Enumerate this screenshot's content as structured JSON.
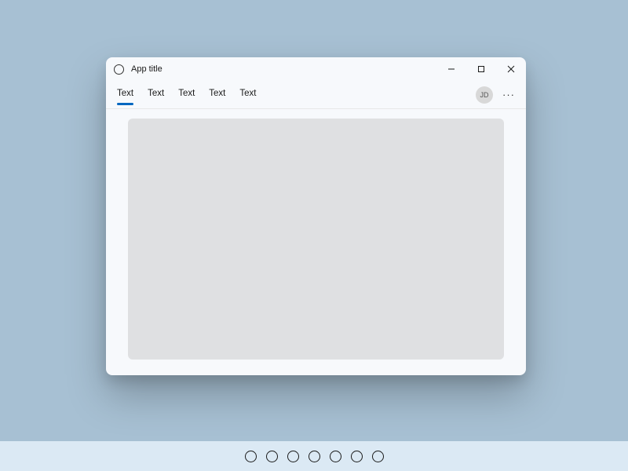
{
  "window": {
    "title": "App title",
    "avatar_initials": "JD",
    "tabs": [
      {
        "label": "Text",
        "active": true
      },
      {
        "label": "Text",
        "active": false
      },
      {
        "label": "Text",
        "active": false
      },
      {
        "label": "Text",
        "active": false
      },
      {
        "label": "Text",
        "active": false
      }
    ]
  },
  "taskbar": {
    "icon_count": 7
  }
}
